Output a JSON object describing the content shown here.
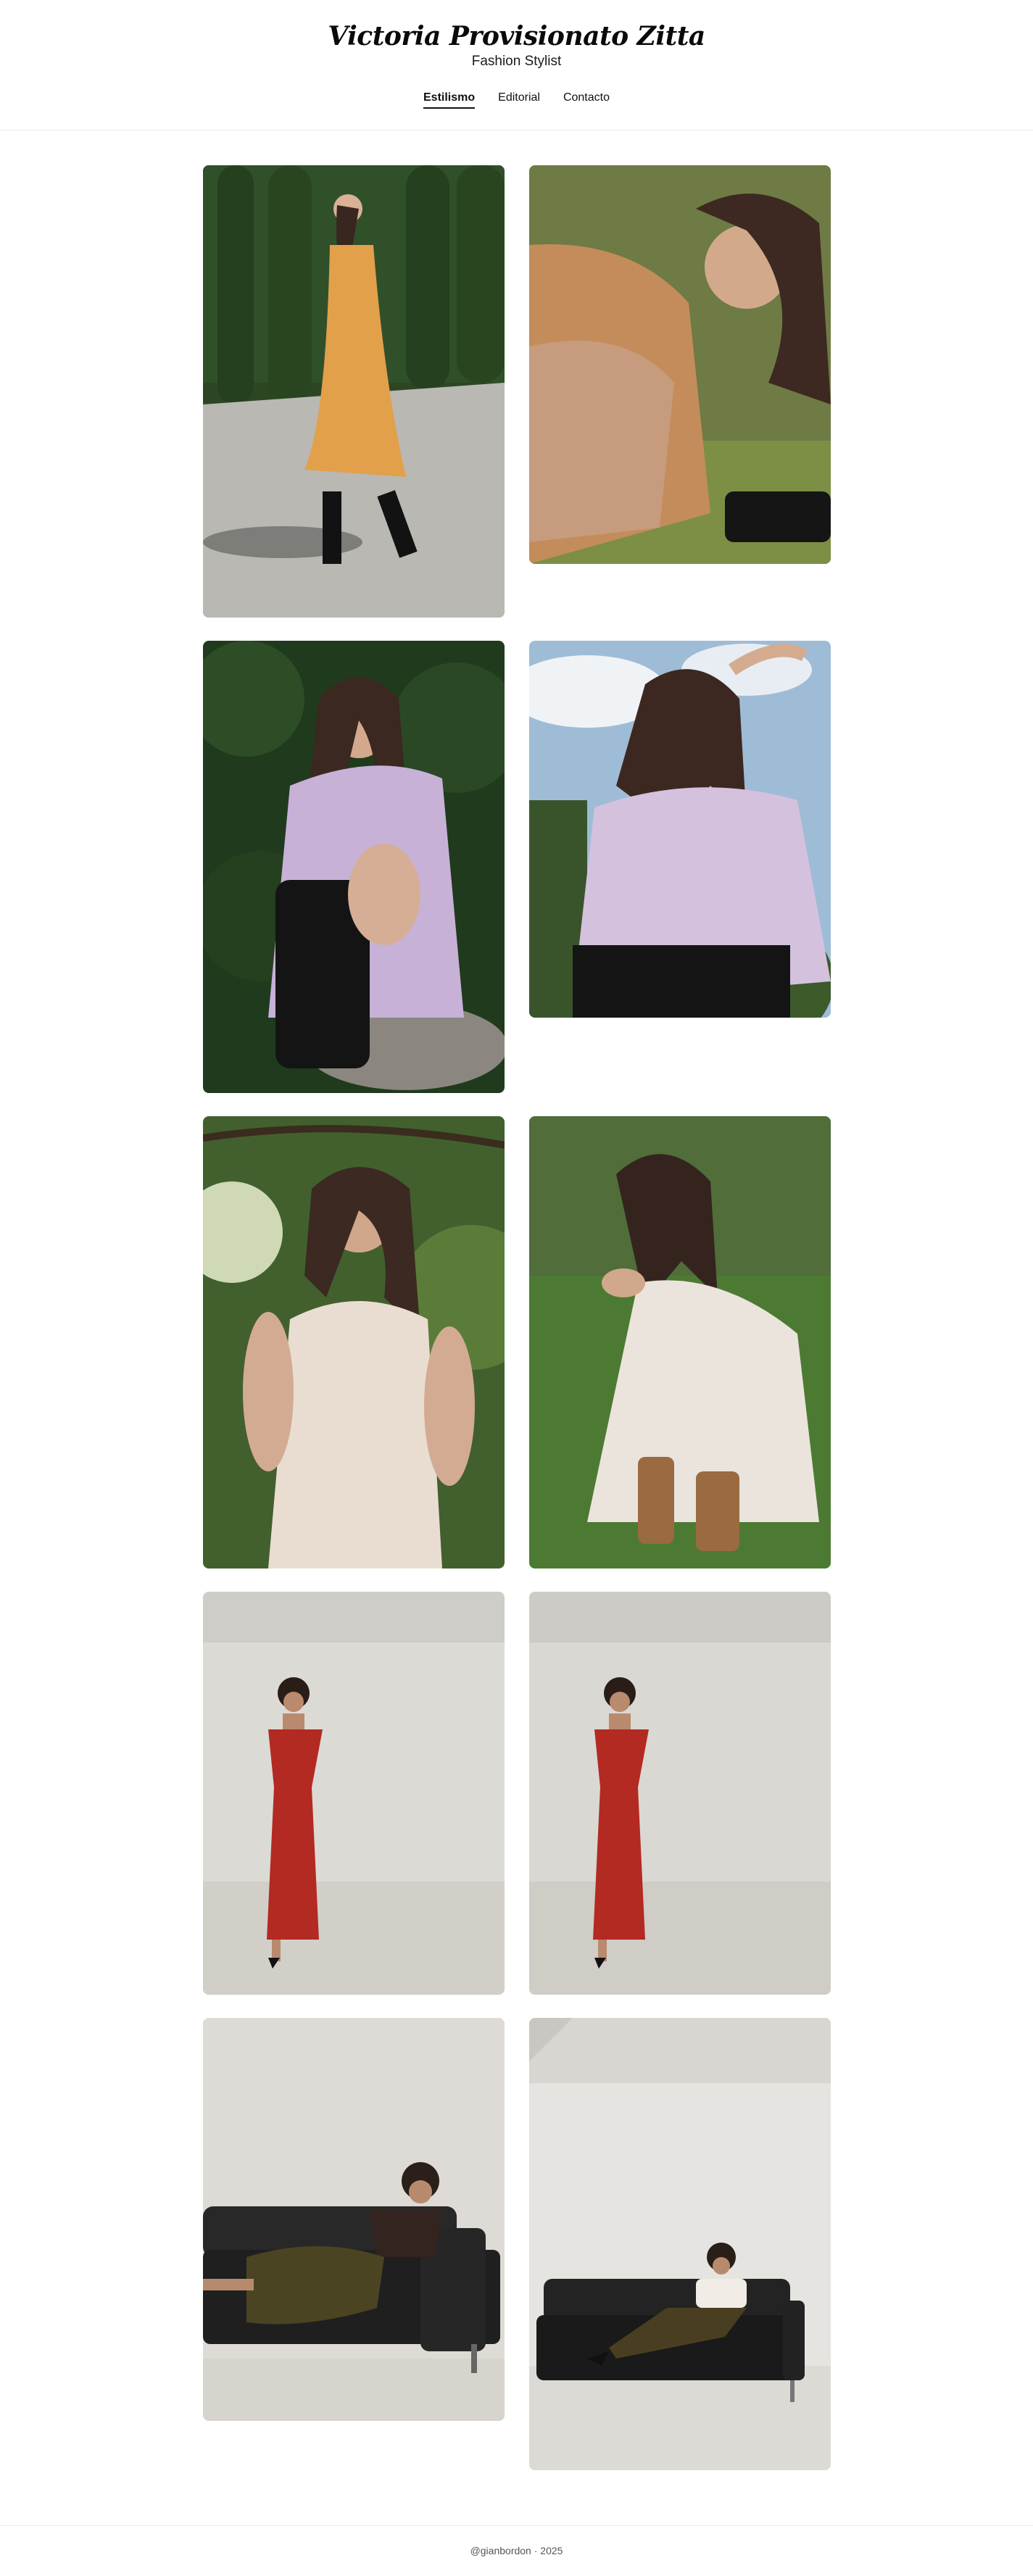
{
  "header": {
    "title": "Victoria Provisionato Zitta",
    "subtitle": "Fashion Stylist"
  },
  "nav": {
    "items": [
      {
        "label": "Estilismo",
        "active": true
      },
      {
        "label": "Editorial",
        "active": false
      },
      {
        "label": "Contacto",
        "active": false
      }
    ]
  },
  "gallery": {
    "photos": [
      {
        "subject": "Woman in orange floral midi dress and black boots walking on path by hedge",
        "bg": "#2f4a26",
        "accent": "#e3a04c"
      },
      {
        "subject": "Close-up of woman with long hair sitting, knees up, floral dress and black boots",
        "bg": "#5b6b3a",
        "accent": "#c48d5d"
      },
      {
        "subject": "Woman in lilac sheer blouse and black boots seated on stone, hugging knees",
        "bg": "#1f3a1d",
        "accent": "#c8b3d8"
      },
      {
        "subject": "Woman in lilac ruffled blouse against blue sky with hair blowing",
        "bg": "#9cb8d4",
        "accent": "#d2c0dc"
      },
      {
        "subject": "Woman in cream crochet knit dress under tree branches",
        "bg": "#3f5a2b",
        "accent": "#eadfd4"
      },
      {
        "subject": "Woman crouching on grass in white crochet dress and brown boots",
        "bg": "#4f7a36",
        "accent": "#ece6df"
      },
      {
        "subject": "Woman in red off-shoulder gown with slit in white studio",
        "bg": "#dedcd7",
        "accent": "#b72a22"
      },
      {
        "subject": "Woman in red off-shoulder gown with slit in white studio, second take",
        "bg": "#dcdad5",
        "accent": "#b72a22"
      },
      {
        "subject": "Woman reclining on black leather sofa in brown top and olive skirt",
        "bg": "#dedbd6",
        "accent": "#222222"
      },
      {
        "subject": "Woman seated on black leather sofa in white strapless top in studio",
        "bg": "#e6e4e0",
        "accent": "#1e1e1e"
      }
    ]
  },
  "footer": {
    "text": "@gianbordon · 2025"
  }
}
